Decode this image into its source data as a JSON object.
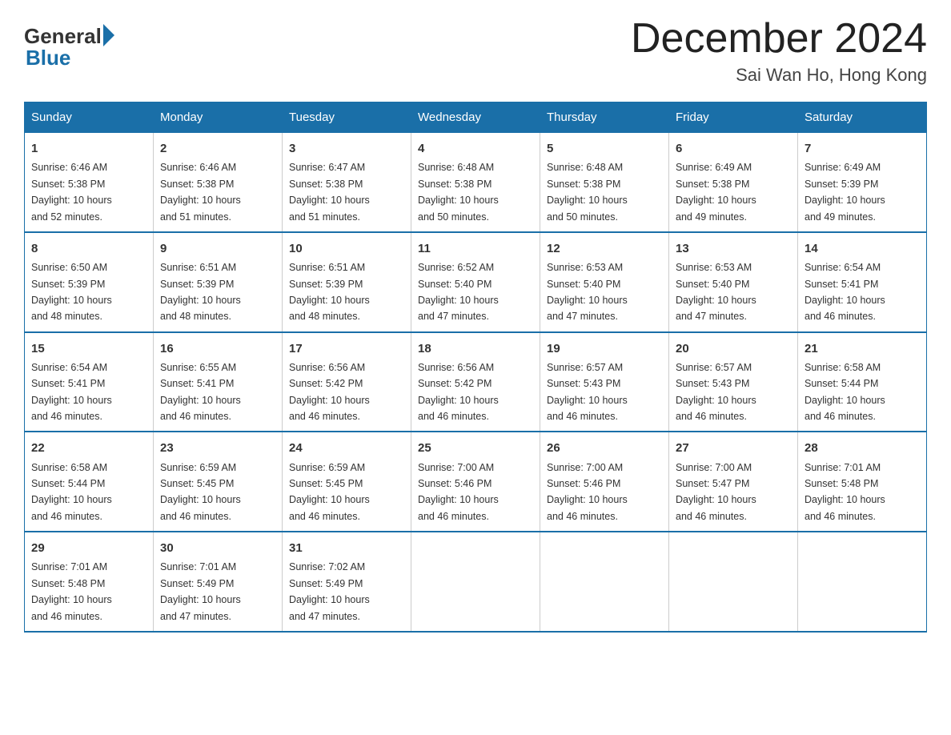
{
  "header": {
    "logo_general": "General",
    "logo_blue": "Blue",
    "month": "December 2024",
    "location": "Sai Wan Ho, Hong Kong"
  },
  "days_of_week": [
    "Sunday",
    "Monday",
    "Tuesday",
    "Wednesday",
    "Thursday",
    "Friday",
    "Saturday"
  ],
  "weeks": [
    [
      {
        "day": "1",
        "sunrise": "6:46 AM",
        "sunset": "5:38 PM",
        "daylight": "10 hours and 52 minutes."
      },
      {
        "day": "2",
        "sunrise": "6:46 AM",
        "sunset": "5:38 PM",
        "daylight": "10 hours and 51 minutes."
      },
      {
        "day": "3",
        "sunrise": "6:47 AM",
        "sunset": "5:38 PM",
        "daylight": "10 hours and 51 minutes."
      },
      {
        "day": "4",
        "sunrise": "6:48 AM",
        "sunset": "5:38 PM",
        "daylight": "10 hours and 50 minutes."
      },
      {
        "day": "5",
        "sunrise": "6:48 AM",
        "sunset": "5:38 PM",
        "daylight": "10 hours and 50 minutes."
      },
      {
        "day": "6",
        "sunrise": "6:49 AM",
        "sunset": "5:38 PM",
        "daylight": "10 hours and 49 minutes."
      },
      {
        "day": "7",
        "sunrise": "6:49 AM",
        "sunset": "5:39 PM",
        "daylight": "10 hours and 49 minutes."
      }
    ],
    [
      {
        "day": "8",
        "sunrise": "6:50 AM",
        "sunset": "5:39 PM",
        "daylight": "10 hours and 48 minutes."
      },
      {
        "day": "9",
        "sunrise": "6:51 AM",
        "sunset": "5:39 PM",
        "daylight": "10 hours and 48 minutes."
      },
      {
        "day": "10",
        "sunrise": "6:51 AM",
        "sunset": "5:39 PM",
        "daylight": "10 hours and 48 minutes."
      },
      {
        "day": "11",
        "sunrise": "6:52 AM",
        "sunset": "5:40 PM",
        "daylight": "10 hours and 47 minutes."
      },
      {
        "day": "12",
        "sunrise": "6:53 AM",
        "sunset": "5:40 PM",
        "daylight": "10 hours and 47 minutes."
      },
      {
        "day": "13",
        "sunrise": "6:53 AM",
        "sunset": "5:40 PM",
        "daylight": "10 hours and 47 minutes."
      },
      {
        "day": "14",
        "sunrise": "6:54 AM",
        "sunset": "5:41 PM",
        "daylight": "10 hours and 46 minutes."
      }
    ],
    [
      {
        "day": "15",
        "sunrise": "6:54 AM",
        "sunset": "5:41 PM",
        "daylight": "10 hours and 46 minutes."
      },
      {
        "day": "16",
        "sunrise": "6:55 AM",
        "sunset": "5:41 PM",
        "daylight": "10 hours and 46 minutes."
      },
      {
        "day": "17",
        "sunrise": "6:56 AM",
        "sunset": "5:42 PM",
        "daylight": "10 hours and 46 minutes."
      },
      {
        "day": "18",
        "sunrise": "6:56 AM",
        "sunset": "5:42 PM",
        "daylight": "10 hours and 46 minutes."
      },
      {
        "day": "19",
        "sunrise": "6:57 AM",
        "sunset": "5:43 PM",
        "daylight": "10 hours and 46 minutes."
      },
      {
        "day": "20",
        "sunrise": "6:57 AM",
        "sunset": "5:43 PM",
        "daylight": "10 hours and 46 minutes."
      },
      {
        "day": "21",
        "sunrise": "6:58 AM",
        "sunset": "5:44 PM",
        "daylight": "10 hours and 46 minutes."
      }
    ],
    [
      {
        "day": "22",
        "sunrise": "6:58 AM",
        "sunset": "5:44 PM",
        "daylight": "10 hours and 46 minutes."
      },
      {
        "day": "23",
        "sunrise": "6:59 AM",
        "sunset": "5:45 PM",
        "daylight": "10 hours and 46 minutes."
      },
      {
        "day": "24",
        "sunrise": "6:59 AM",
        "sunset": "5:45 PM",
        "daylight": "10 hours and 46 minutes."
      },
      {
        "day": "25",
        "sunrise": "7:00 AM",
        "sunset": "5:46 PM",
        "daylight": "10 hours and 46 minutes."
      },
      {
        "day": "26",
        "sunrise": "7:00 AM",
        "sunset": "5:46 PM",
        "daylight": "10 hours and 46 minutes."
      },
      {
        "day": "27",
        "sunrise": "7:00 AM",
        "sunset": "5:47 PM",
        "daylight": "10 hours and 46 minutes."
      },
      {
        "day": "28",
        "sunrise": "7:01 AM",
        "sunset": "5:48 PM",
        "daylight": "10 hours and 46 minutes."
      }
    ],
    [
      {
        "day": "29",
        "sunrise": "7:01 AM",
        "sunset": "5:48 PM",
        "daylight": "10 hours and 46 minutes."
      },
      {
        "day": "30",
        "sunrise": "7:01 AM",
        "sunset": "5:49 PM",
        "daylight": "10 hours and 47 minutes."
      },
      {
        "day": "31",
        "sunrise": "7:02 AM",
        "sunset": "5:49 PM",
        "daylight": "10 hours and 47 minutes."
      },
      null,
      null,
      null,
      null
    ]
  ],
  "labels": {
    "sunrise": "Sunrise:",
    "sunset": "Sunset:",
    "daylight": "Daylight:"
  }
}
